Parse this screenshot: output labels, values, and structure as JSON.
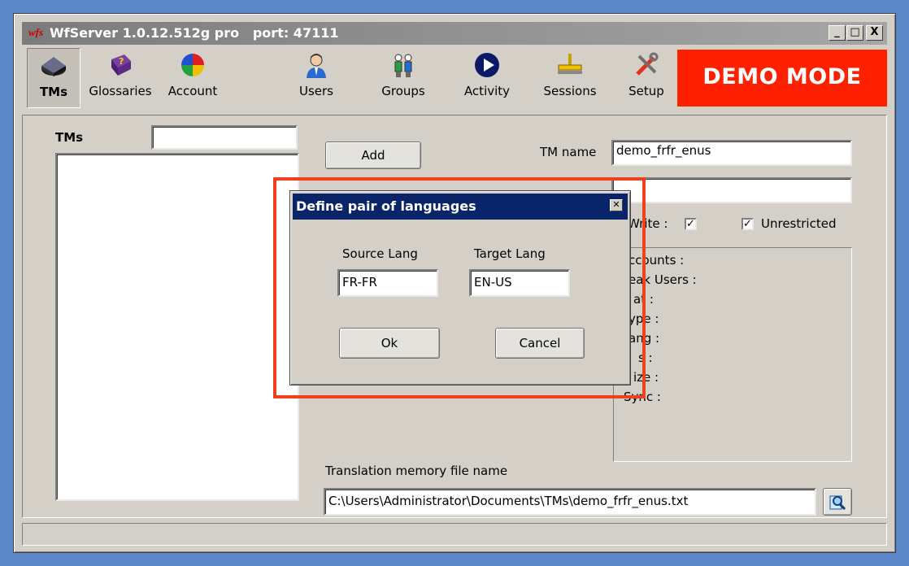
{
  "window": {
    "logo_text": "wfs",
    "title": "WfServer 1.0.12.512g pro   port: 47111",
    "minimize_glyph": "_",
    "maximize_glyph": "□",
    "close_glyph": "X"
  },
  "toolbar": {
    "items": [
      {
        "label": "TMs",
        "icon": "tm-disk-icon",
        "active": true
      },
      {
        "label": "Glossaries",
        "icon": "glossary-book-icon"
      },
      {
        "label": "Account",
        "icon": "account-pie-icon"
      },
      {
        "label": "Users",
        "icon": "user-person-icon"
      },
      {
        "label": "Groups",
        "icon": "groups-people-icon"
      },
      {
        "label": "Activity",
        "icon": "activity-play-icon"
      },
      {
        "label": "Sessions",
        "icon": "sessions-network-icon"
      },
      {
        "label": "Setup",
        "icon": "setup-tools-icon"
      }
    ],
    "demo_badge": "DEMO MODE"
  },
  "tm_panel": {
    "label": "TMs",
    "filter_value": "",
    "add_button": "Add",
    "tm_name_label": "TM name",
    "tm_name_value": "demo_frfr_enus",
    "write_label": "Write :",
    "write_checked": true,
    "unrestricted_label": "Unrestricted",
    "unrestricted_checked": true,
    "stats_visible": [
      "ccounts :",
      "eak Users :",
      "at  :",
      "ype :",
      "ang :",
      "s :",
      "ize :",
      "Sync :"
    ],
    "file_label": "Translation memory file name",
    "file_path": "C:\\Users\\Administrator\\Documents\\TMs\\demo_frfr_enus.txt"
  },
  "dialog": {
    "title": "Define pair of languages",
    "close_glyph": "✕",
    "source_label": "Source Lang",
    "source_value": "FR-FR",
    "target_label": "Target Lang",
    "target_value": "EN-US",
    "ok_button": "Ok",
    "cancel_button": "Cancel"
  },
  "colors": {
    "desktop": "#5b87c8",
    "dialog_title_bg": "#0a246a",
    "demo_badge_bg": "#ff2000",
    "highlight_border": "#f0401e"
  }
}
